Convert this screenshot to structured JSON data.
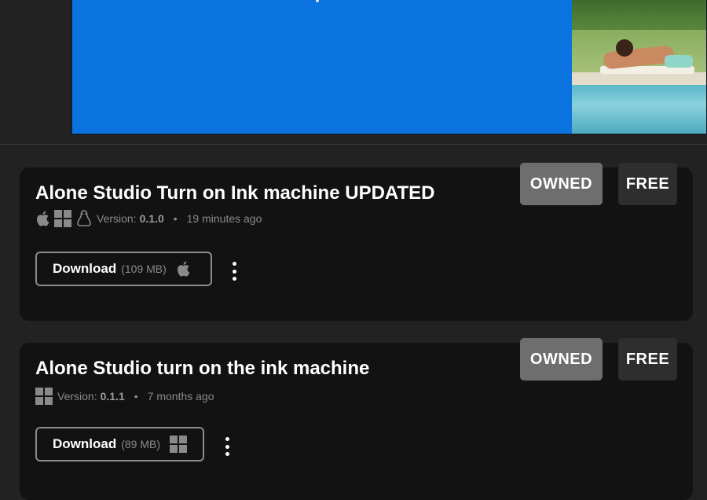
{
  "banner": {
    "color": "#0a73e0"
  },
  "builds": [
    {
      "title": "Alone Studio Turn on Ink machine UPDATED",
      "platform_icons": [
        "apple-icon",
        "windows-icon",
        "linux-icon"
      ],
      "version_label": "Version:",
      "version": "0.1.0",
      "time": "19 minutes ago",
      "tags": {
        "owned": "OWNED",
        "free": "FREE"
      },
      "download": {
        "label": "Download",
        "size": "(109 MB)",
        "icon": "apple-icon"
      }
    },
    {
      "title": "Alone Studio turn on the ink machine",
      "platform_icons": [
        "windows-icon"
      ],
      "version_label": "Version:",
      "version": "0.1.1",
      "time": "7 months ago",
      "tags": {
        "owned": "OWNED",
        "free": "FREE"
      },
      "download": {
        "label": "Download",
        "size": "(89 MB)",
        "icon": "windows-icon"
      }
    }
  ],
  "bullet": "•",
  "colors": {
    "card_bg": "#121212",
    "page_bg": "#222222",
    "owned_tag": "#6e6e6e",
    "free_tag": "#2e2e2e"
  }
}
